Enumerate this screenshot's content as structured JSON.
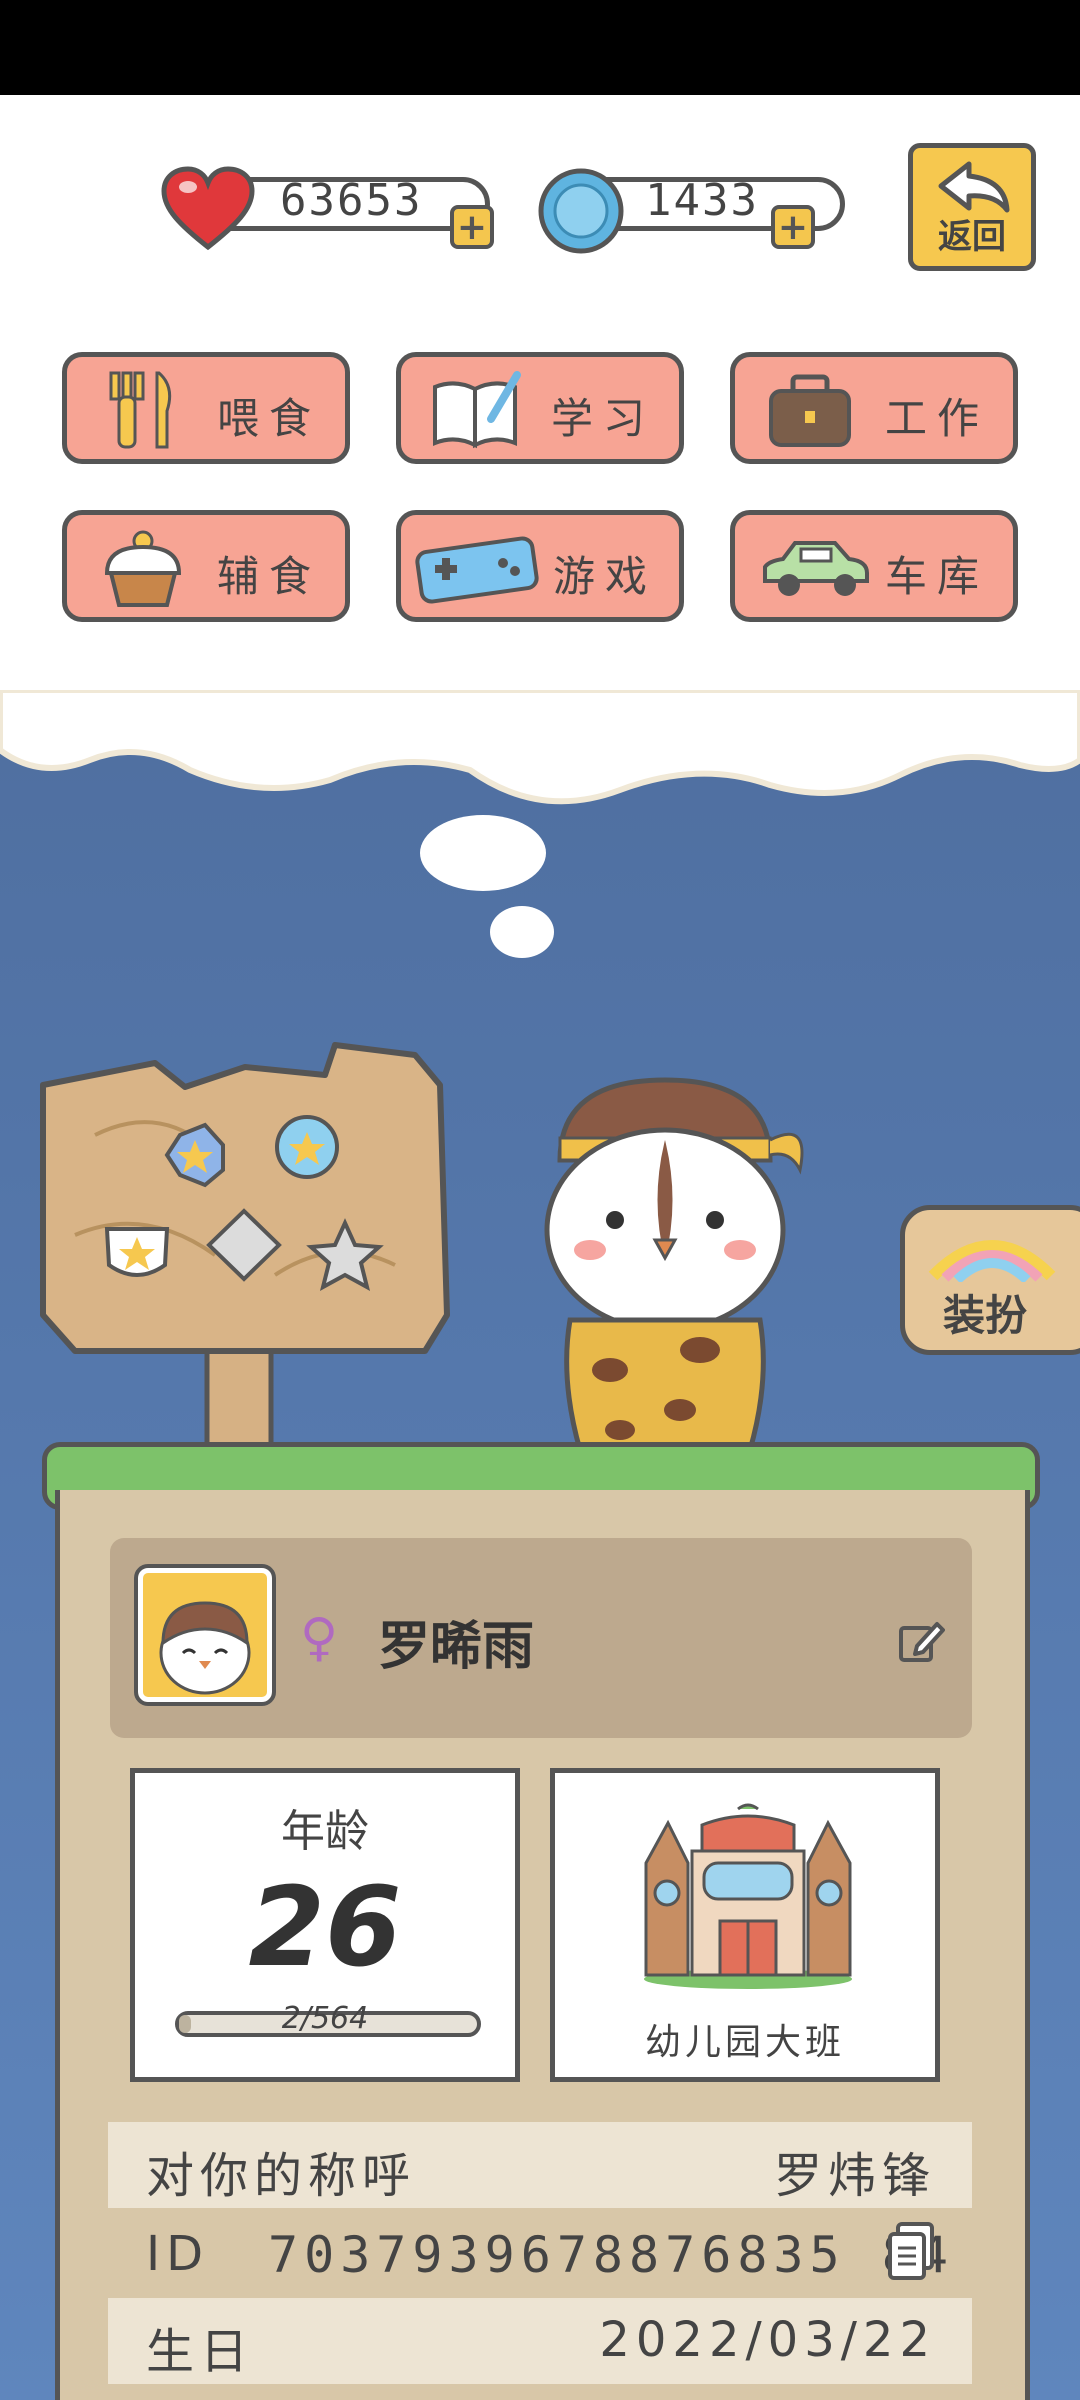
{
  "currency": {
    "hearts": "63653",
    "coins": "1433"
  },
  "back_label": "返回",
  "menu": [
    {
      "label": "喂食",
      "icon": "fork-knife-icon"
    },
    {
      "label": "学习",
      "icon": "book-pen-icon"
    },
    {
      "label": "工作",
      "icon": "briefcase-icon"
    },
    {
      "label": "辅食",
      "icon": "cupcake-icon"
    },
    {
      "label": "游戏",
      "icon": "gamepad-icon"
    },
    {
      "label": "车库",
      "icon": "car-icon"
    }
  ],
  "dress_up_label": "装扮",
  "profile": {
    "gender_symbol": "♀",
    "name": "罗晞雨"
  },
  "age": {
    "label": "年龄",
    "value": "26",
    "progress_text": "2/564",
    "progress_fraction": 0.0035
  },
  "school": {
    "label": "幼儿园大班"
  },
  "info": {
    "nickname_key": "对你的称呼",
    "nickname_value": "罗炜锋",
    "id_key": "ID",
    "id_value": "7037939678876835 84",
    "birthday_key": "生日",
    "birthday_value": "2022/03/22"
  },
  "colors": {
    "menu_bg": "#f7a494",
    "accent_yellow": "#f6c84f",
    "sky": "#5578ac",
    "grass": "#7dc26a",
    "panel": "#d8c7a8"
  }
}
